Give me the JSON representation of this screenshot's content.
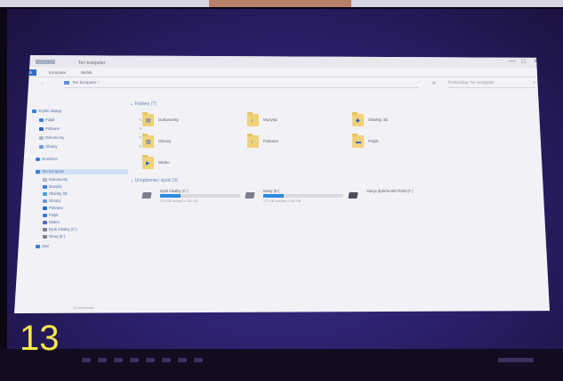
{
  "window": {
    "title": "Ten komputer",
    "controls": [
      "—",
      "□",
      "×"
    ]
  },
  "ribbon": {
    "tabs": [
      "Plik",
      "Komputer",
      "Widok"
    ]
  },
  "address": {
    "path": "Ten komputer",
    "search_placeholder": "Przeszukaj: Ten komputer"
  },
  "nav": {
    "quick_access": "Szybki dostęp",
    "quick_items": [
      "Pulpit",
      "Pobrane",
      "Dokumenty",
      "Obrazy"
    ],
    "onedrive": "OneDrive",
    "this_pc": "Ten komputer",
    "pc_items": [
      "Dokumenty",
      "Muzyka",
      "Obiekty 3D",
      "Obrazy",
      "Pobrane",
      "Pulpit",
      "Wideo",
      "Dysk lokalny (C:)",
      "Nowy (E:)"
    ],
    "network": "Sieć"
  },
  "folders": {
    "header": "Foldery (7)",
    "items": [
      "Dokumenty",
      "Muzyka",
      "Obiekty 3D",
      "Obrazy",
      "Pobrane",
      "Pulpit",
      "Wideo"
    ]
  },
  "drives": {
    "header": "Urządzenia i dyski (3)",
    "items": [
      {
        "name": "Dysk lokalny (C:)",
        "free": "174 GB wolnych z 231 GB",
        "fill": 0.25
      },
      {
        "name": "Nowy (E:)",
        "free": "171 GB wolnych z 232 GB",
        "fill": 0.26
      },
      {
        "name": "Stacja dysków BD-ROM (F:)"
      }
    ]
  },
  "status": "10 elementów",
  "badge": "13",
  "colors": {
    "accent": "#2e6fc0",
    "folder": "#efd27a",
    "drive_bar": "#2b8be0",
    "badge": "#f6e84a"
  }
}
